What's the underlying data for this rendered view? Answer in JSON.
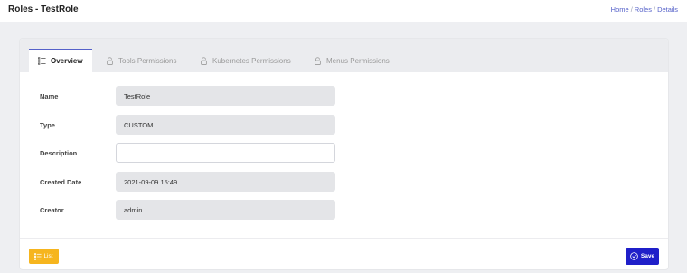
{
  "header": {
    "title": "Roles - TestRole",
    "breadcrumb": [
      "Home",
      "Roles",
      "Details"
    ]
  },
  "tabs": [
    {
      "label": "Overview",
      "icon": "list-icon",
      "active": true
    },
    {
      "label": "Tools Permissions",
      "icon": "lock-icon",
      "active": false
    },
    {
      "label": "Kubernetes Permissions",
      "icon": "lock-icon",
      "active": false
    },
    {
      "label": "Menus Permissions",
      "icon": "lock-icon",
      "active": false
    }
  ],
  "form": {
    "name": {
      "label": "Name",
      "value": "TestRole"
    },
    "type": {
      "label": "Type",
      "value": "CUSTOM"
    },
    "description": {
      "label": "Description",
      "value": "",
      "placeholder": ""
    },
    "created_date": {
      "label": "Created Date",
      "value": "2021-09-09 15:49"
    },
    "creator": {
      "label": "Creator",
      "value": "admin"
    }
  },
  "actions": {
    "list_label": "List",
    "save_label": "Save"
  },
  "colors": {
    "accent": "#5561c9",
    "save": "#1f1fc9",
    "list": "#f6b51e"
  }
}
